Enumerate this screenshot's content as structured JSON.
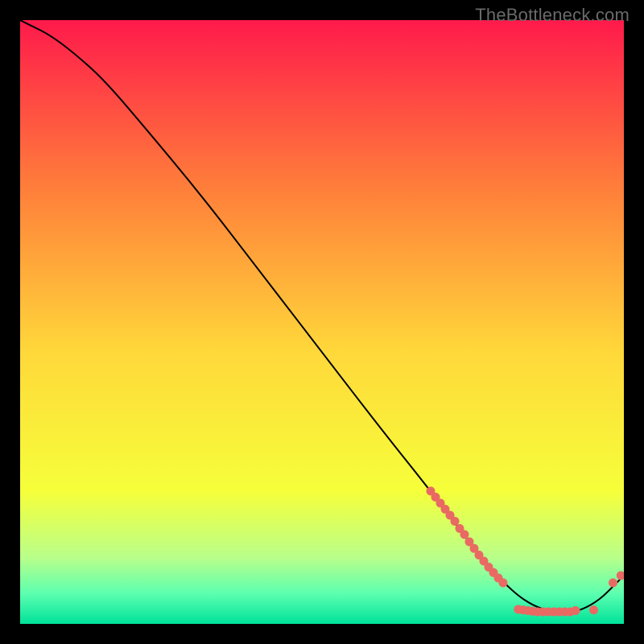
{
  "watermark": "TheBottleneck.com",
  "colors": {
    "gradient_top": "#ff1a4b",
    "gradient_mid_upper": "#ff7f3a",
    "gradient_mid": "#ffd83a",
    "gradient_mid_lower": "#f6ff3a",
    "gradient_green_top": "#b9ff8a",
    "gradient_green_mid": "#5cffb0",
    "gradient_bottom": "#00e29a",
    "curve": "#000000",
    "dots": "#e86a63",
    "background": "#000000"
  },
  "chart_data": {
    "type": "line",
    "title": "",
    "xlabel": "",
    "ylabel": "",
    "xlim": [
      0,
      100
    ],
    "ylim": [
      0,
      100
    ],
    "curve": [
      {
        "x": 0,
        "y": 100
      },
      {
        "x": 2,
        "y": 99
      },
      {
        "x": 5,
        "y": 97.5
      },
      {
        "x": 9,
        "y": 94.5
      },
      {
        "x": 14,
        "y": 90
      },
      {
        "x": 20,
        "y": 83
      },
      {
        "x": 30,
        "y": 71
      },
      {
        "x": 40,
        "y": 58
      },
      {
        "x": 50,
        "y": 45
      },
      {
        "x": 60,
        "y": 32
      },
      {
        "x": 68,
        "y": 22
      },
      {
        "x": 74,
        "y": 14
      },
      {
        "x": 78,
        "y": 9
      },
      {
        "x": 82,
        "y": 5
      },
      {
        "x": 85,
        "y": 3
      },
      {
        "x": 88,
        "y": 2
      },
      {
        "x": 91,
        "y": 2
      },
      {
        "x": 93,
        "y": 2.3
      },
      {
        "x": 96,
        "y": 4
      },
      {
        "x": 98.5,
        "y": 6.5
      },
      {
        "x": 100,
        "y": 8
      }
    ],
    "dots": [
      {
        "x": 68.0,
        "y": 22.0
      },
      {
        "x": 68.8,
        "y": 21.0
      },
      {
        "x": 69.6,
        "y": 20.0
      },
      {
        "x": 70.4,
        "y": 19.0
      },
      {
        "x": 71.2,
        "y": 18.0
      },
      {
        "x": 72.0,
        "y": 17.0
      },
      {
        "x": 72.8,
        "y": 15.8
      },
      {
        "x": 73.6,
        "y": 14.8
      },
      {
        "x": 74.4,
        "y": 13.6
      },
      {
        "x": 75.2,
        "y": 12.5
      },
      {
        "x": 76.0,
        "y": 11.4
      },
      {
        "x": 76.8,
        "y": 10.4
      },
      {
        "x": 77.6,
        "y": 9.4
      },
      {
        "x": 78.4,
        "y": 8.5
      },
      {
        "x": 79.2,
        "y": 7.6
      },
      {
        "x": 80.0,
        "y": 6.8
      },
      {
        "x": 82.5,
        "y": 2.4
      },
      {
        "x": 83.3,
        "y": 2.3
      },
      {
        "x": 84.1,
        "y": 2.2
      },
      {
        "x": 84.9,
        "y": 2.1
      },
      {
        "x": 85.7,
        "y": 2.0
      },
      {
        "x": 86.6,
        "y": 2.0
      },
      {
        "x": 87.5,
        "y": 2.0
      },
      {
        "x": 88.4,
        "y": 2.0
      },
      {
        "x": 89.3,
        "y": 2.0
      },
      {
        "x": 90.2,
        "y": 2.0
      },
      {
        "x": 91.1,
        "y": 2.0
      },
      {
        "x": 92.0,
        "y": 2.2
      },
      {
        "x": 95.0,
        "y": 2.3
      },
      {
        "x": 98.2,
        "y": 6.8
      },
      {
        "x": 99.5,
        "y": 8.0
      }
    ]
  }
}
